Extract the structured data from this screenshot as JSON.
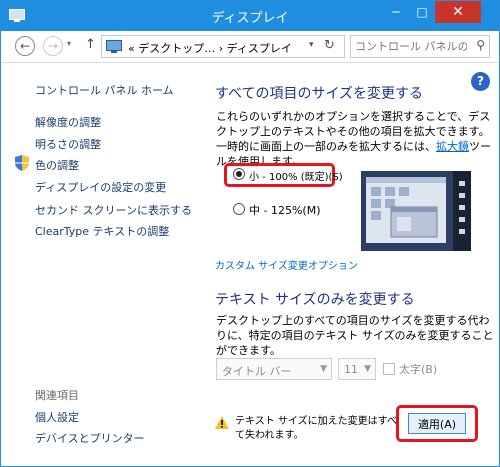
{
  "window": {
    "title": "ディスプレイ"
  },
  "titlebar_buttons": {
    "minimize": "─",
    "maximize": "□",
    "close": "✕"
  },
  "navigation": {
    "back": "←",
    "forward": "→",
    "recent": "▾",
    "up": "↑",
    "address": "« デスクトップ… › ディスプレイ",
    "address_dropdown": "▾",
    "refresh": "↻",
    "search_placeholder": "コントロール パネルの…",
    "search_icon": "⚲"
  },
  "sidebar": {
    "home": "コントロール パネル ホーム",
    "items": [
      "解像度の調整",
      "明るさの調整",
      "色の調整",
      "ディスプレイの設定の変更",
      "セカンド スクリーンに表示する",
      "ClearType テキストの調整"
    ],
    "related_heading": "関連項目",
    "related": [
      "個人設定",
      "デバイスとプリンター"
    ]
  },
  "main": {
    "help": "?",
    "section1_title": "すべての項目のサイズを変更する",
    "desc1_part1": "これらのいずれかのオプションを選択することで、デスクトップ上のテキストやその他の項目を拡大できます。一時的に画面上の一部のみを拡大するには、",
    "desc1_link": "拡大鏡",
    "desc1_part2": "ツールを使用します。",
    "option_small": "小 - 100% (既定)(S)",
    "option_medium": "中 - 125%(M)",
    "option_selected": "small",
    "custom_link": "カスタム サイズ変更オプション",
    "section2_title": "テキスト サイズのみを変更する",
    "desc2": "デスクトップ上のすべての項目のサイズを変更する代わりに、特定の項目のテキスト サイズのみを変更することができます。",
    "item_select_value": "タイトル バー",
    "size_select_value": "11",
    "bold_label": "太字(B)",
    "bold_checked": false,
    "warning": "テキスト サイズに加えた変更はすべて失われます。",
    "apply_button": "適用(A)"
  },
  "colors": {
    "titlebar": "#1f8ee0",
    "heading": "#1e3287",
    "link": "#0066cc",
    "highlight": "#e8141e"
  },
  "icons": [
    "app-window-icon",
    "shield-icon",
    "warning-icon",
    "help-icon",
    "search-icon",
    "refresh-icon"
  ]
}
